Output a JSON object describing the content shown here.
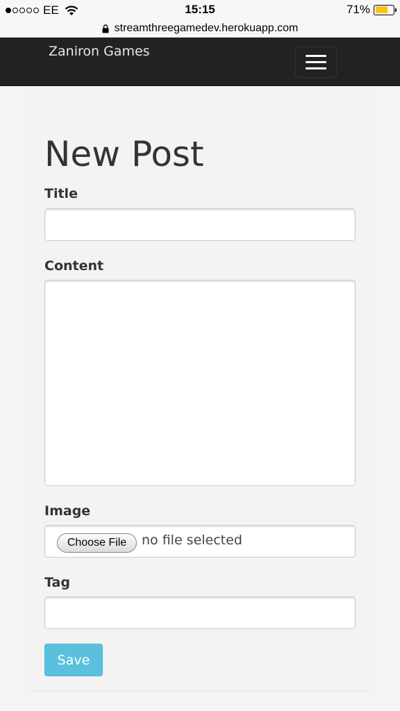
{
  "status_bar": {
    "carrier": "EE",
    "time": "15:15",
    "battery": "71%",
    "battery_level": 0.71,
    "signal_bars": 1,
    "signal_total": 5
  },
  "url_bar": {
    "url": "streamthreegamedev.herokuapp.com"
  },
  "navbar": {
    "brand": "Zaniron Games",
    "toggle_icon": "hamburger-menu-icon"
  },
  "form": {
    "title": "New Post",
    "fields": {
      "title_label": "Title",
      "title_value": "",
      "content_label": "Content",
      "content_value": "",
      "image_label": "Image",
      "choose_file_label": "Choose File",
      "no_file_text": "no file selected",
      "tag_label": "Tag",
      "tag_value": ""
    },
    "save_label": "Save"
  },
  "colors": {
    "navbar_bg": "#222222",
    "page_bg": "#f4f4f4",
    "save_button": "#5bc0de",
    "battery_fill": "#f5c31c"
  }
}
